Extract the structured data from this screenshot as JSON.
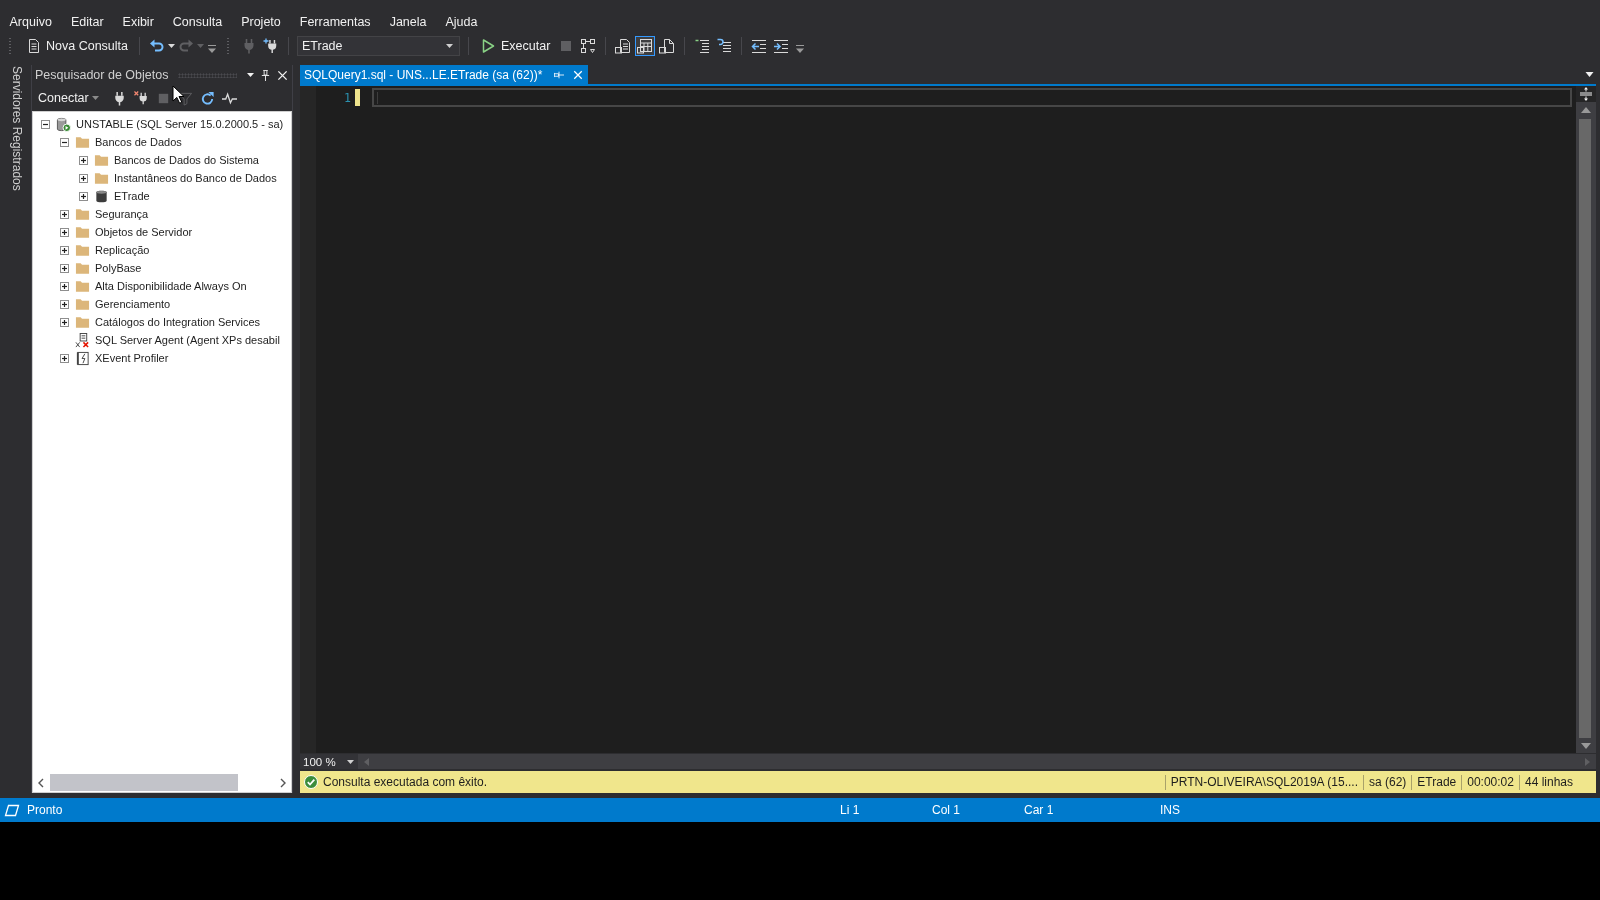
{
  "menu": [
    "Arquivo",
    "Editar",
    "Exibir",
    "Consulta",
    "Projeto",
    "Ferramentas",
    "Janela",
    "Ajuda"
  ],
  "toolbars": [
    {
      "groups": [
        [
          {
            "kind": "new-query",
            "label": "Nova Consulta",
            "disabled": false
          }
        ],
        [
          {
            "kind": "undo",
            "disabled": false
          },
          {
            "kind": "redo",
            "disabled": true
          }
        ]
      ]
    },
    {
      "groups": [
        [
          {
            "kind": "connect",
            "disabled": true
          },
          {
            "kind": "change-connection",
            "disabled": false
          }
        ],
        [
          {
            "kind": "database",
            "value": "ETrade",
            "disabled": false
          }
        ],
        [
          {
            "kind": "execute",
            "label": "Executar",
            "disabled": false
          },
          {
            "kind": "stop",
            "disabled": true
          },
          {
            "kind": "estimated-plan",
            "disabled": false
          }
        ],
        [
          {
            "kind": "results-text",
            "selected": false,
            "disabled": false
          },
          {
            "kind": "results-grid",
            "selected": true,
            "disabled": false
          },
          {
            "kind": "results-file",
            "selected": false,
            "disabled": false
          }
        ],
        [
          {
            "kind": "comment",
            "disabled": false
          },
          {
            "kind": "uncomment",
            "disabled": false
          }
        ],
        [
          {
            "kind": "outdent",
            "disabled": false
          },
          {
            "kind": "indent",
            "disabled": false
          }
        ]
      ]
    }
  ],
  "side_tabs": [
    "Servidores Registrados"
  ],
  "object_explorer": {
    "title": "Pesquisador de Objetos",
    "connect": "Conectar",
    "tools": [
      {
        "kind": "connect",
        "disabled": false
      },
      {
        "kind": "disconnect",
        "disabled": false
      },
      {
        "kind": "stop",
        "disabled": true
      },
      {
        "kind": "filter",
        "disabled": true
      },
      {
        "kind": "refresh",
        "disabled": false
      },
      {
        "kind": "activity-monitor",
        "disabled": false
      }
    ],
    "tree": [
      {
        "label": "UNSTABLE (SQL Server 15.0.2000.5 - sa)",
        "kind": "server",
        "expanded": true,
        "leaf": false,
        "children": [
          {
            "label": "Bancos de Dados",
            "kind": "folder",
            "expanded": true,
            "leaf": false,
            "children": [
              {
                "label": "Bancos de Dados do Sistema",
                "kind": "folder",
                "expanded": false,
                "leaf": false
              },
              {
                "label": "Instantâneos do Banco de Dados",
                "kind": "folder",
                "expanded": false,
                "leaf": false
              },
              {
                "label": "ETrade",
                "kind": "database",
                "expanded": false,
                "leaf": false
              }
            ]
          },
          {
            "label": "Segurança",
            "kind": "folder",
            "expanded": false,
            "leaf": false
          },
          {
            "label": "Objetos de Servidor",
            "kind": "folder",
            "expanded": false,
            "leaf": false
          },
          {
            "label": "Replicação",
            "kind": "folder",
            "expanded": false,
            "leaf": false
          },
          {
            "label": "PolyBase",
            "kind": "folder",
            "expanded": false,
            "leaf": false
          },
          {
            "label": "Alta Disponibilidade Always On",
            "kind": "folder",
            "expanded": false,
            "leaf": false
          },
          {
            "label": "Gerenciamento",
            "kind": "folder",
            "expanded": false,
            "leaf": false
          },
          {
            "label": "Catálogos do Integration Services",
            "kind": "folder",
            "expanded": false,
            "leaf": false
          },
          {
            "label": "SQL Server Agent (Agent XPs desabil",
            "kind": "agent",
            "expanded": false,
            "leaf": true
          },
          {
            "label": "XEvent Profiler",
            "kind": "xevent",
            "expanded": false,
            "leaf": false
          }
        ]
      }
    ]
  },
  "editor": {
    "tabs": [
      {
        "title": "SQLQuery1.sql - UNS...LE.ETrade (sa (62))*",
        "selected": true
      }
    ],
    "lines": [
      {
        "number": "1",
        "modified": true,
        "current": true
      }
    ],
    "zoom": "100 %"
  },
  "message_bar": {
    "kind": "success",
    "text": "Consulta executada com êxito.",
    "fields": [
      "PRTN-OLIVEIRA\\SQL2019A (15....",
      "sa (62)",
      "ETrade",
      "00:00:02",
      "44 linhas"
    ]
  },
  "status_bar": {
    "text": "Pronto",
    "fields": [
      "Li 1",
      "Col 1",
      "Car 1",
      "INS"
    ]
  }
}
